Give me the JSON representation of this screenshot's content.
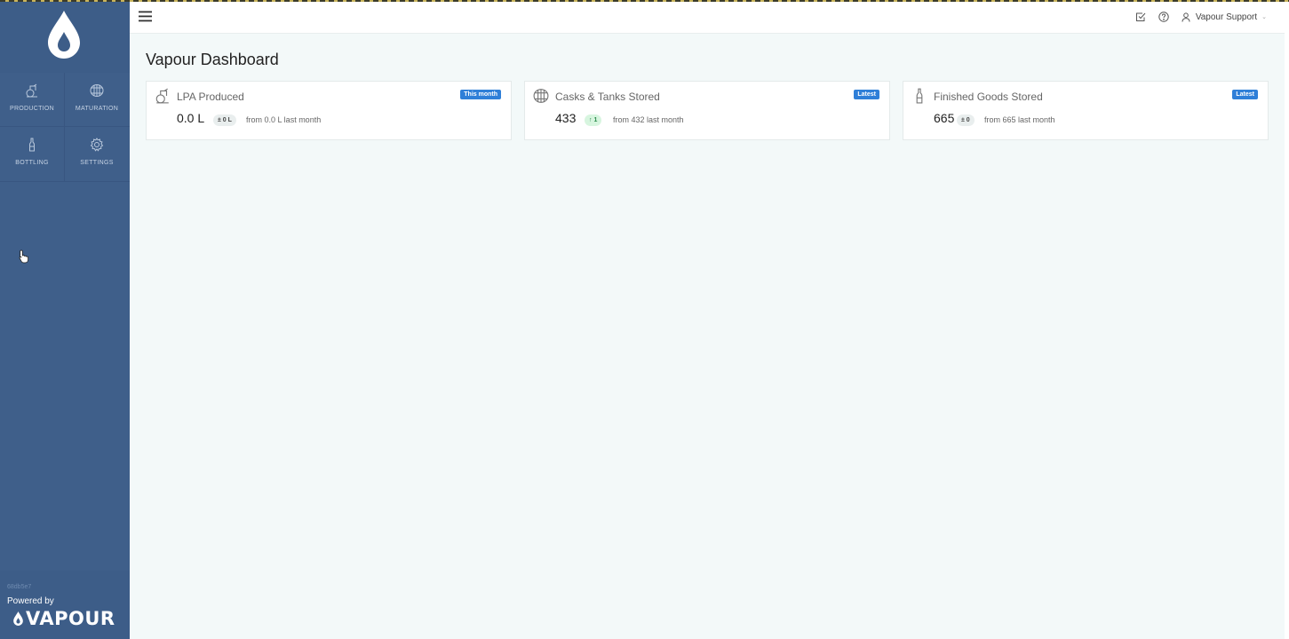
{
  "header": {
    "user_name": "Vapour Support"
  },
  "sidebar": {
    "items": [
      {
        "label": "PRODUCTION",
        "icon": "still-icon"
      },
      {
        "label": "MATURATION",
        "icon": "barrel-icon"
      },
      {
        "label": "BOTTLING",
        "icon": "bottle-icon"
      },
      {
        "label": "SETTINGS",
        "icon": "gear-icon"
      }
    ],
    "build_hash": "68db5e7",
    "powered_by": "Powered by",
    "brand": "VAPOUR"
  },
  "page": {
    "title": "Vapour Dashboard"
  },
  "cards": [
    {
      "title": "LPA Produced",
      "badge": "This month",
      "value": "0.0 L",
      "change": "± 0 L",
      "change_type": "neutral",
      "from": "from 0.0 L last month"
    },
    {
      "title": "Casks & Tanks Stored",
      "badge": "Latest",
      "value": "433",
      "change": "↑ 1",
      "change_type": "up",
      "from": "from 432 last month"
    },
    {
      "title": "Finished Goods Stored",
      "badge": "Latest",
      "value": "665",
      "change": "± 0",
      "change_type": "neutral",
      "from": "from 665 last month"
    }
  ],
  "colors": {
    "sidebar": "#3f5f8a",
    "badge": "#2f7fd8",
    "background": "#f3f9f9"
  }
}
